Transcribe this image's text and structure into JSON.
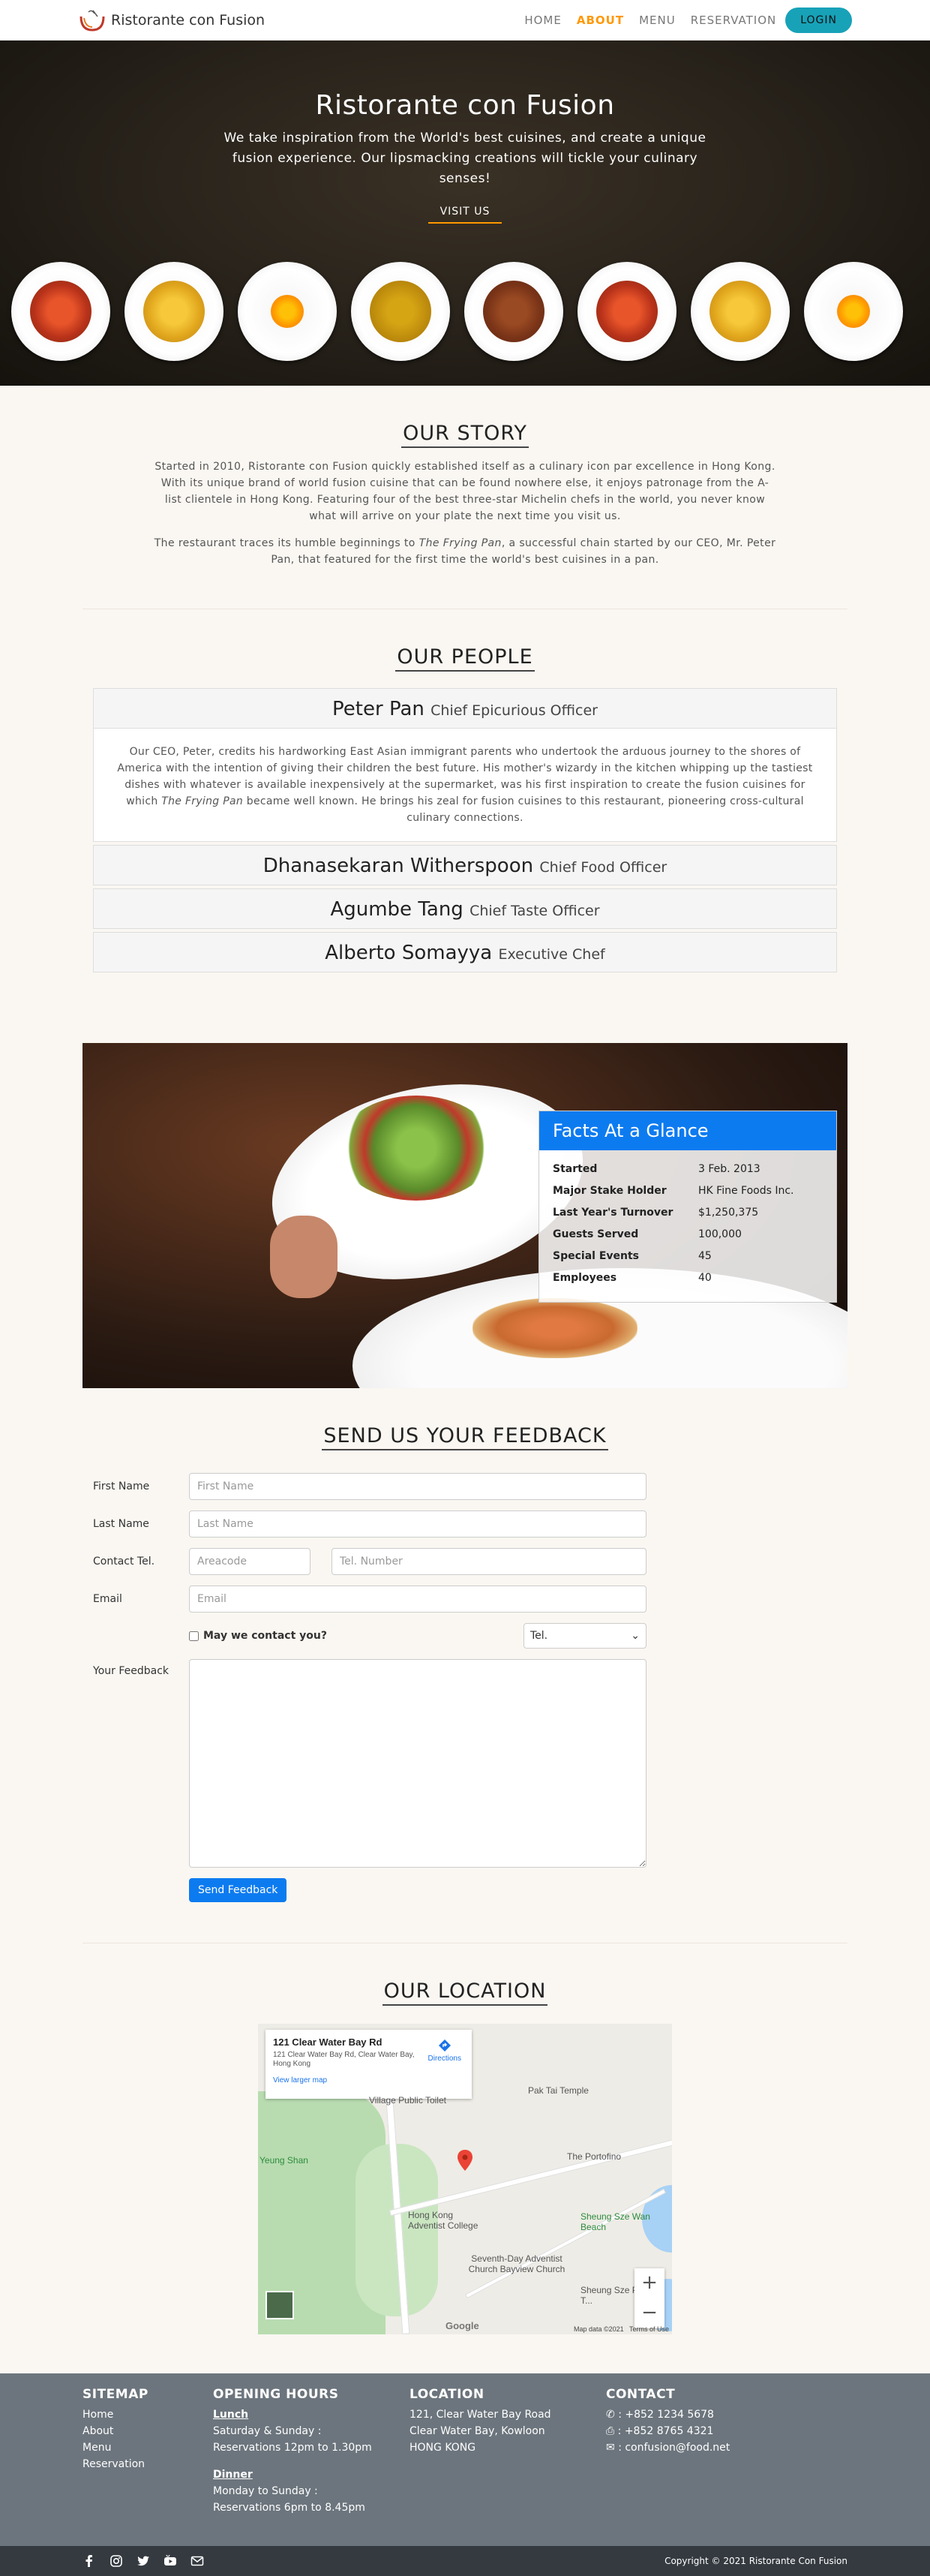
{
  "nav": {
    "brand": "Ristorante con Fusion",
    "links": [
      "HOME",
      "ABOUT",
      "MENU",
      "RESERVATION"
    ],
    "active": "ABOUT",
    "login": "LOGIN"
  },
  "hero": {
    "title": "Ristorante con Fusion",
    "subtitle": "We take inspiration from the World's best cuisines, and create a unique fusion experience. Our lipsmacking creations will tickle your culinary senses!",
    "button": "VISIT US"
  },
  "story": {
    "title": "OUR STORY",
    "p1": "Started in 2010, Ristorante con Fusion quickly established itself as a culinary icon par excellence in Hong Kong. With its unique brand of world fusion cuisine that can be found nowhere else, it enjoys patronage from the A-list clientele in Hong Kong. Featuring four of the best three-star Michelin chefs in the world, you never know what will arrive on your plate the next time you visit us.",
    "p2_before": "The restaurant traces its humble beginnings to ",
    "p2_em": "The Frying Pan",
    "p2_after": ", a successful chain started by our CEO, Mr. Peter Pan, that featured for the first time the world's best cuisines in a pan."
  },
  "people": {
    "title": "OUR PEOPLE",
    "leaders": [
      {
        "name": "Peter Pan",
        "role": "Chief Epicurious Officer"
      },
      {
        "name": "Dhanasekaran Witherspoon",
        "role": "Chief Food Officer"
      },
      {
        "name": "Agumbe Tang",
        "role": "Chief Taste Officer"
      },
      {
        "name": "Alberto Somayya",
        "role": "Executive Chef"
      }
    ],
    "peter_bio_before": "Our CEO, Peter, credits his hardworking East Asian immigrant parents who undertook the arduous journey to the shores of America with the intention of giving their children the best future. His mother's wizardy in the kitchen whipping up the tastiest dishes with whatever is available inexpensively at the supermarket, was his first inspiration to create the fusion cuisines for which ",
    "peter_bio_em": "The Frying Pan",
    "peter_bio_after": " became well known. He brings his zeal for fusion cuisines to this restaurant, pioneering cross-cultural culinary connections."
  },
  "facts": {
    "title": "Facts At a Glance",
    "rows": [
      {
        "k": "Started",
        "v": "3 Feb. 2013"
      },
      {
        "k": "Major Stake Holder",
        "v": "HK Fine Foods Inc."
      },
      {
        "k": "Last Year's Turnover",
        "v": "$1,250,375"
      },
      {
        "k": "Guests Served",
        "v": "100,000"
      },
      {
        "k": "Special Events",
        "v": "45"
      },
      {
        "k": "Employees",
        "v": "40"
      }
    ]
  },
  "feedback": {
    "title": "SEND US YOUR FEEDBACK",
    "first_label": "First Name",
    "first_ph": "First Name",
    "last_label": "Last Name",
    "last_ph": "Last Name",
    "tel_label": "Contact Tel.",
    "area_ph": "Areacode",
    "tel_ph": "Tel. Number",
    "email_label": "Email",
    "email_ph": "Email",
    "contact_check": "May we contact you?",
    "select_value": "Tel.",
    "feedback_label": "Your Feedback",
    "submit": "Send Feedback"
  },
  "location": {
    "title": "OUR LOCATION",
    "popup_title": "121 Clear Water Bay Rd",
    "popup_addr": "121 Clear Water Bay Rd, Clear Water Bay, Hong Kong",
    "popup_link": "View larger map",
    "popup_dir": "Directions",
    "labels": {
      "village": "Village Public Toilet",
      "pak_tai": "Pak Tai Temple",
      "portofino": "The Portofino",
      "yeung": "Yeung Shan",
      "hk_adventist": "Hong Kong Adventist College",
      "seventh": "Seventh-Day Adventist Church Bayview Church",
      "sheung_wan": "Sheung Sze Wan Beach",
      "sheung_toilet": "Sheung Sze Public T..."
    },
    "map_data": "Map data ©2021",
    "terms": "Terms of Use",
    "google": "Google"
  },
  "footer": {
    "sitemap_title": "SITEMAP",
    "sitemap": [
      "Home",
      "About",
      "Menu",
      "Reservation"
    ],
    "hours_title": "OPENING HOURS",
    "lunch": "Lunch",
    "lunch_days": "Saturday & Sunday :",
    "lunch_time": "Reservations 12pm to 1.30pm",
    "dinner": "Dinner",
    "dinner_days": "Monday to Sunday :",
    "dinner_time": "Reservations 6pm to 8.45pm",
    "location_title": "LOCATION",
    "addr1": "121, Clear Water Bay Road",
    "addr2": "Clear Water Bay, Kowloon",
    "addr3": "HONG KONG",
    "contact_title": "CONTACT",
    "phone": ": +852 1234 5678",
    "fax": ": +852 8765 4321",
    "email": ": confusion@food.net",
    "copyright": "Copyright © 2021 Ristorante Con Fusion"
  },
  "colors": {
    "accent": "#ff9800",
    "login": "#17a2b8",
    "primary": "#0d7bf0",
    "footer": "#6c757d",
    "footer_bottom": "#343a40"
  }
}
